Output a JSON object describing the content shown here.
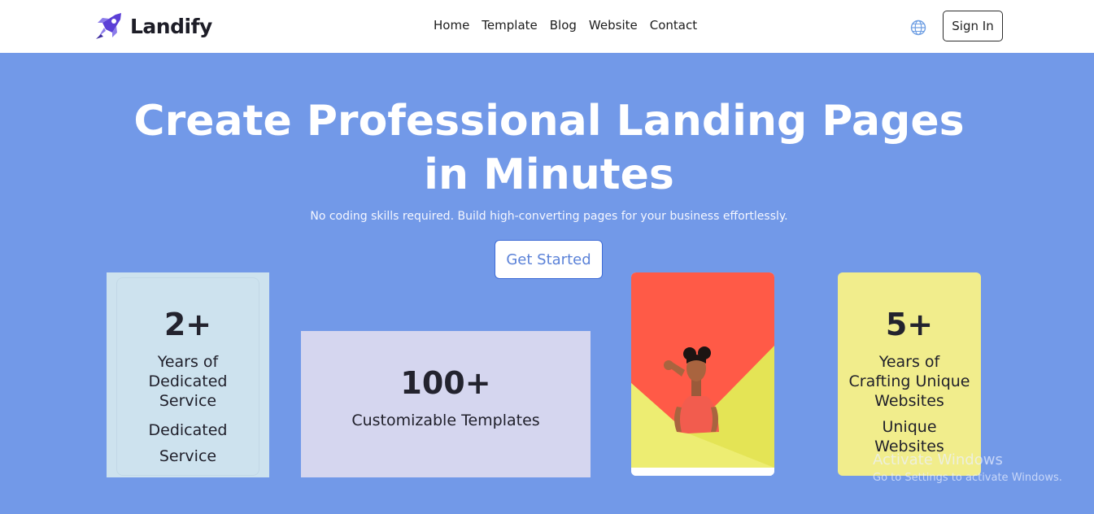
{
  "navbar": {
    "brand": "Landify",
    "links": [
      "Home",
      "Template",
      "Blog",
      "Website",
      "Contact"
    ],
    "globe_icon": "globe-icon",
    "signin_label": "Sign In"
  },
  "hero": {
    "title": "Create Professional Landing Pages in Minutes",
    "subtitle": "No coding skills required. Build high-converting pages for your business effortlessly.",
    "cta_label": "Get Started"
  },
  "stats": {
    "years": {
      "number": "2+",
      "label": "Years of Dedicated Service",
      "label_repeat": "Dedicated Service"
    },
    "templates": {
      "number": "100+",
      "label": "Customizable Templates"
    },
    "websites": {
      "number": "5+",
      "label": "Years of Crafting Unique Websites",
      "label_repeat": "Unique Websites"
    }
  },
  "watermark": {
    "title": "Activate Windows",
    "subtitle": "Go to Settings to activate Windows."
  },
  "colors": {
    "hero_bg": "#7299e8",
    "card_blue": "#cde2ee",
    "card_lavender": "#d5d6ef",
    "card_yellow": "#f1ed8c",
    "photo_red": "#ff5a47",
    "photo_yellow": "#e4e455",
    "brand_purple": "#5b3fd6"
  }
}
